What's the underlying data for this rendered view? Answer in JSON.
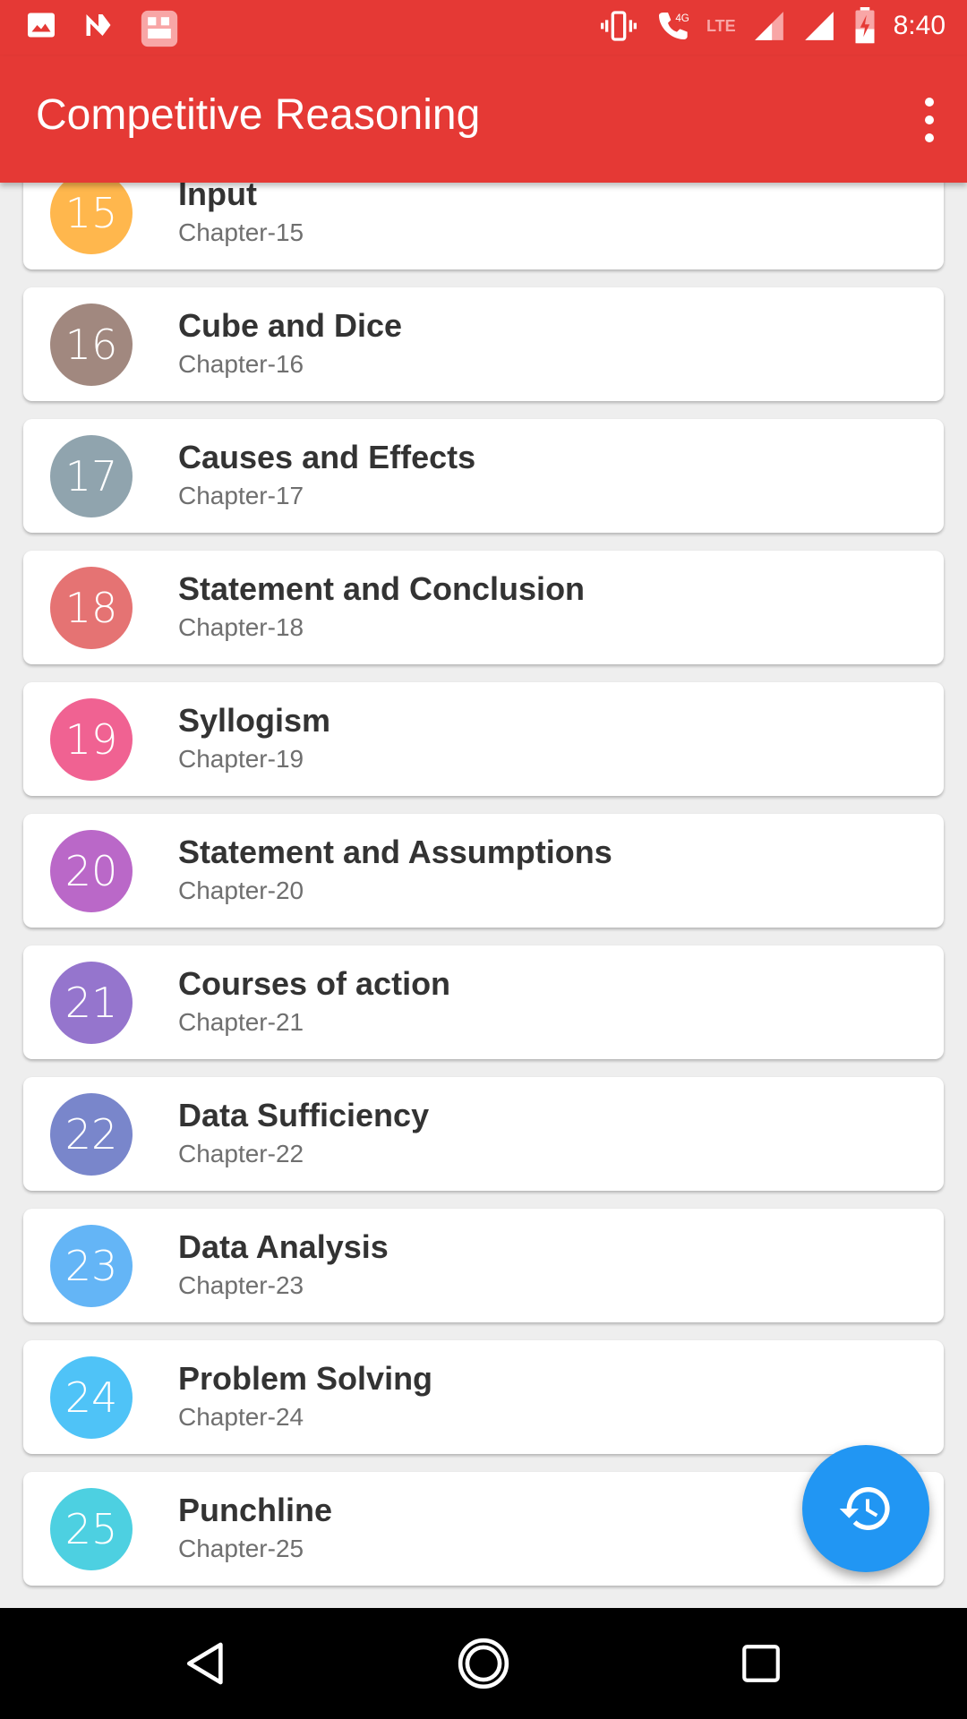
{
  "status_bar": {
    "time": "8:40",
    "network_label": "4G",
    "lte_label": "LTE",
    "left_icons": [
      "image-icon",
      "n-notification-icon",
      "app-notification-icon"
    ],
    "right_icons": [
      "vibrate-icon",
      "wifi-call-icon",
      "signal-icon",
      "signal-icon",
      "battery-charging-icon"
    ]
  },
  "app_bar": {
    "title": "Competitive Reasoning",
    "menu_icon": "more-vert-icon"
  },
  "chapters": [
    {
      "number": "15",
      "title": "Input",
      "subtitle": "Chapter-15",
      "color": "#ffb74d"
    },
    {
      "number": "16",
      "title": "Cube and Dice",
      "subtitle": "Chapter-16",
      "color": "#a1887f"
    },
    {
      "number": "17",
      "title": "Causes and Effects",
      "subtitle": "Chapter-17",
      "color": "#90a4ae"
    },
    {
      "number": "18",
      "title": "Statement and Conclusion",
      "subtitle": "Chapter-18",
      "color": "#e57373"
    },
    {
      "number": "19",
      "title": "Syllogism",
      "subtitle": "Chapter-19",
      "color": "#f06292"
    },
    {
      "number": "20",
      "title": "Statement and Assumptions",
      "subtitle": "Chapter-20",
      "color": "#ba68c8"
    },
    {
      "number": "21",
      "title": "Courses of action",
      "subtitle": "Chapter-21",
      "color": "#9575cd"
    },
    {
      "number": "22",
      "title": "Data Sufficiency",
      "subtitle": "Chapter-22",
      "color": "#7986cb"
    },
    {
      "number": "23",
      "title": "Data Analysis",
      "subtitle": "Chapter-23",
      "color": "#64b5f6"
    },
    {
      "number": "24",
      "title": "Problem Solving",
      "subtitle": "Chapter-24",
      "color": "#4fc3f7"
    },
    {
      "number": "25",
      "title": "Punchline",
      "subtitle": "Chapter-25",
      "color": "#4dd0e1"
    }
  ],
  "fab": {
    "icon": "history-icon",
    "color": "#2196f3"
  },
  "nav_bar": {
    "buttons": [
      "back-icon",
      "home-icon",
      "recents-icon"
    ]
  },
  "colors": {
    "primary": "#e53935",
    "background": "#eeeeee"
  }
}
